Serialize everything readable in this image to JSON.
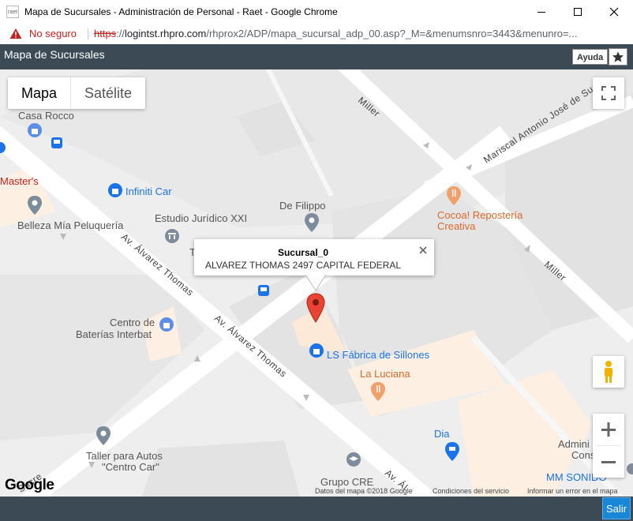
{
  "window": {
    "title": "Mapa de Sucursales - Administración de Personal - Raet - Google Chrome",
    "app_icon_text": "raet"
  },
  "address_bar": {
    "security_label": "No seguro",
    "url_scheme": "https",
    "url_sep": "://",
    "url_host": "logintst.rhpro.com",
    "url_path": "/rhprox2/ADP/mapa_sucursal_adp_00.asp?_M=&menumsnro=3443&menunro=..."
  },
  "app_header": {
    "title": "Mapa de Sucursales",
    "help_label": "Ayuda"
  },
  "map": {
    "map_type": {
      "map_label": "Mapa",
      "satellite_label": "Satélite",
      "selected": "Mapa"
    },
    "streets": {
      "miller_1": "Miller",
      "miller_2": "Miller",
      "mariscal": "Mariscal Antonio José de Sucre",
      "alvarez_1": "Av. Álvarez Thomas",
      "alvarez_2": "Av. Álvarez Thomas",
      "alvarez_3": "Av. Ál",
      "sucre": "Sucre"
    },
    "pois": {
      "casa_rocco": "Casa Rocco",
      "masters": "Master's",
      "infiniti_car": "Infiniti Car",
      "belleza": "Belleza Mía Peluquería",
      "estudio": "Estudio Jurídico XXI",
      "de_filippo": "De Filippo",
      "cocoa_1": "Cocoa! Repostería",
      "cocoa_2": "Creativa",
      "centro_baterias_1": "Centro de",
      "centro_baterias_2": "Baterías Interbat",
      "ls_fabrica": "LS Fábrica de Sillones",
      "la_luciana": "La Luciana",
      "dia": "Dia",
      "admin_1": "Admini",
      "admin_2": "Consi",
      "mm_sonido": "MM SONIDO",
      "taller_1": "Taller para Autos",
      "taller_2": "\"Centro Car\"",
      "grupo_cre": "Grupo CRE",
      "t_partial": "T"
    },
    "info_window": {
      "title": "Sucursal_0",
      "address": "ALVAREZ THOMAS 2497 CAPITAL FEDERAL"
    },
    "attribution": {
      "logo": "Google",
      "map_data": "Datos del mapa ©2018 Google",
      "terms": "Condiciones del servicio",
      "report": "Informar un error en el mapa"
    },
    "colors": {
      "poi_blue": "#1a73e8",
      "poi_orange": "#f2a06b",
      "marker_red": "#ea4335"
    }
  },
  "bottom_bar": {
    "exit_label": "Salir"
  }
}
